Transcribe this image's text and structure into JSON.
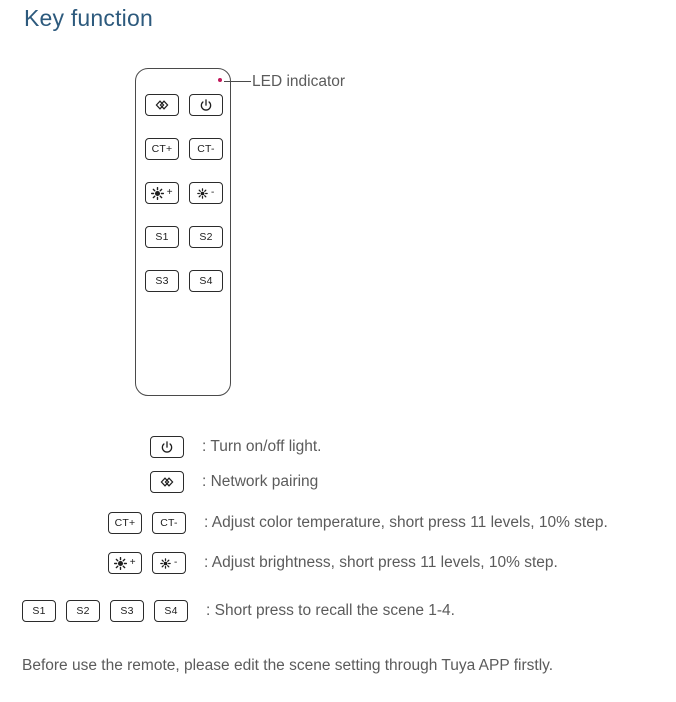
{
  "page": {
    "title": "Key function",
    "footnote": "Before use the remote, please edit the scene setting through Tuya APP firstly."
  },
  "callout": {
    "led_label": "LED indicator",
    "led_color": "#c2185b"
  },
  "remote": {
    "keys": [
      {
        "id": "pairing",
        "label": "",
        "icon": "network-pairing-icon",
        "sign": ""
      },
      {
        "id": "power",
        "label": "",
        "icon": "power-icon",
        "sign": ""
      },
      {
        "id": "ct-plus",
        "label": "CT+",
        "icon": "",
        "sign": ""
      },
      {
        "id": "ct-minus",
        "label": "CT-",
        "icon": "",
        "sign": ""
      },
      {
        "id": "bright-up",
        "label": "",
        "icon": "brightness-icon",
        "sign": "+"
      },
      {
        "id": "bright-dn",
        "label": "",
        "icon": "brightness-icon",
        "sign": "-"
      },
      {
        "id": "scene-1",
        "label": "S1",
        "icon": "",
        "sign": ""
      },
      {
        "id": "scene-2",
        "label": "S2",
        "icon": "",
        "sign": ""
      },
      {
        "id": "scene-3",
        "label": "S3",
        "icon": "",
        "sign": ""
      },
      {
        "id": "scene-4",
        "label": "S4",
        "icon": "",
        "sign": ""
      }
    ]
  },
  "legend": {
    "power": {
      "text": ": Turn on/off light."
    },
    "pairing": {
      "text": ": Network pairing"
    },
    "ct": {
      "key_plus": "CT+",
      "key_minus": "CT-",
      "text": ": Adjust color temperature, short press 11 levels, 10% step."
    },
    "brightness": {
      "sign_plus": "+",
      "sign_minus": "-",
      "text": ": Adjust brightness, short press 11 levels, 10% step."
    },
    "scene": {
      "keys": [
        "S1",
        "S2",
        "S3",
        "S4"
      ],
      "text": ": Short press to recall the scene 1-4."
    }
  }
}
